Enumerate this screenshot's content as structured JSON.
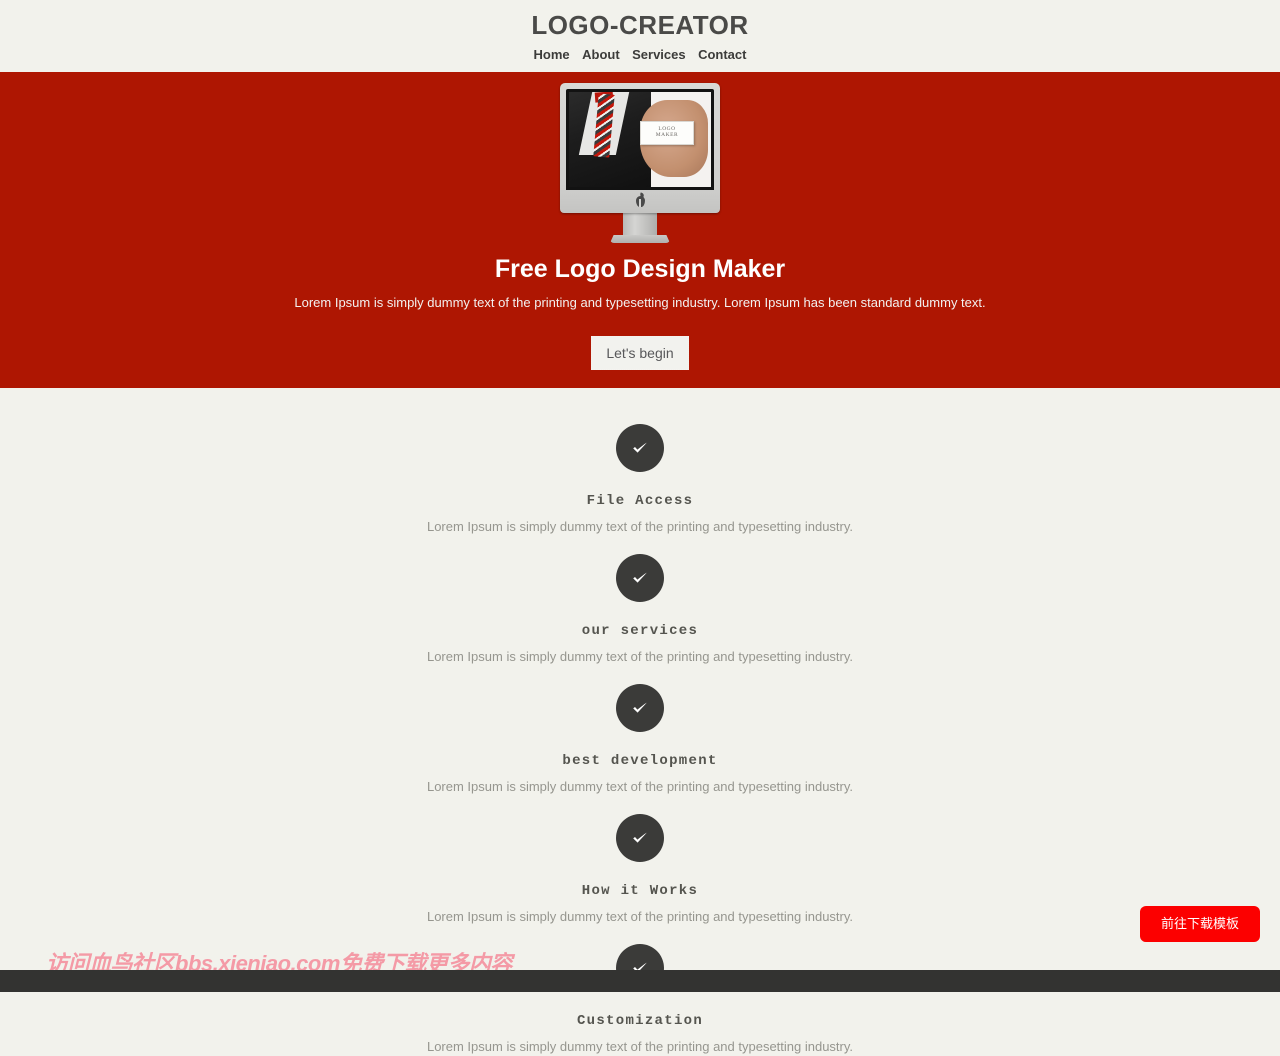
{
  "header": {
    "brand": "LOGO-CREATOR",
    "nav": [
      {
        "label": "Home"
      },
      {
        "label": "About"
      },
      {
        "label": "Services"
      },
      {
        "label": "Contact"
      }
    ]
  },
  "hero": {
    "background_color": "#ae1602",
    "image": {
      "device": "imac-monitor",
      "screen_content": "businessman-holding-business-card",
      "card_line1": "LOGO",
      "card_line2": "MAKER"
    },
    "title": "Free Logo Design Maker",
    "subtitle": "Lorem Ipsum is simply dummy text of the printing and typesetting industry. Lorem Ipsum has been standard dummy text.",
    "cta_label": "Let's begin"
  },
  "features": {
    "icon_name": "check-icon",
    "icon_bg_color": "#3b3b39",
    "items": [
      {
        "title": "File Access",
        "desc": "Lorem Ipsum is simply dummy text of the printing and typesetting industry."
      },
      {
        "title": "our services",
        "desc": "Lorem Ipsum is simply dummy text of the printing and typesetting industry."
      },
      {
        "title": "best development",
        "desc": "Lorem Ipsum is simply dummy text of the printing and typesetting industry."
      },
      {
        "title": "How it Works",
        "desc": "Lorem Ipsum is simply dummy text of the printing and typesetting industry."
      },
      {
        "title": "Customization",
        "desc": "Lorem Ipsum is simply dummy text of the printing and typesetting industry."
      }
    ]
  },
  "watermark": {
    "text": "访问血鸟社区bbs.xieniao.com免费下载更多内容",
    "color": "#f49aa6"
  },
  "download_button": {
    "label": "前往下载模板",
    "color": "#fc0000"
  },
  "footer": {
    "background_color": "#333331"
  }
}
